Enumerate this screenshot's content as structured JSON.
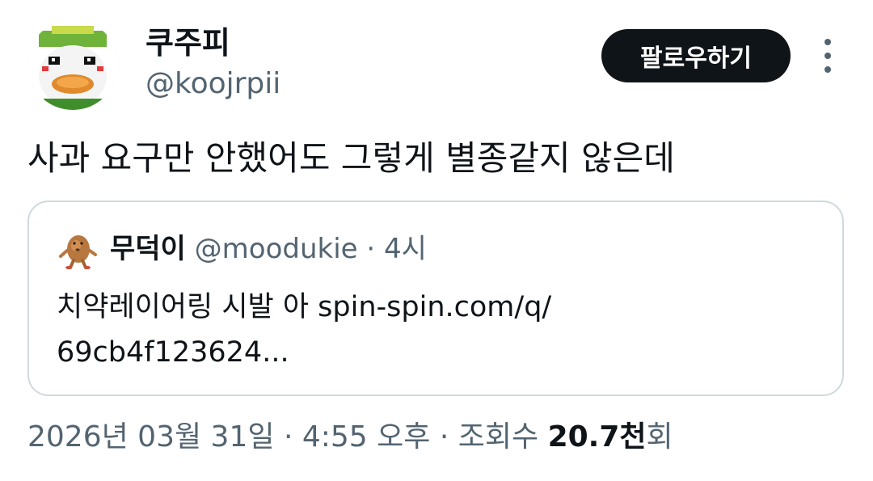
{
  "author": {
    "display_name": "쿠주피",
    "handle": "@koojrpii",
    "avatar_icon": "avatar-cartoon-icon"
  },
  "follow_button": {
    "label": "팔로우하기"
  },
  "more_button": {
    "icon": "more-vertical-icon"
  },
  "tweet": {
    "text": "사과 요구만 안했어도 그렇게 별종같지 않은데"
  },
  "quote": {
    "avatar_icon": "avatar-potato-icon",
    "display_name": "무덕이",
    "handle": "@moodukie",
    "separator": "·",
    "time": "4시",
    "body_line1": "치약레이어링 시발 아 spin-spin.com/q/",
    "body_line2": "69cb4f123624..."
  },
  "meta": {
    "date": "2026년 03월 31일",
    "separator": "·",
    "time": "4:55 오후",
    "views_label": "조회수",
    "views_count": "20.7천",
    "views_suffix": "회"
  },
  "colors": {
    "text_primary": "#0f1419",
    "text_secondary": "#536471",
    "border": "#cfd9de",
    "button_bg": "#0f1419",
    "button_text": "#ffffff"
  }
}
